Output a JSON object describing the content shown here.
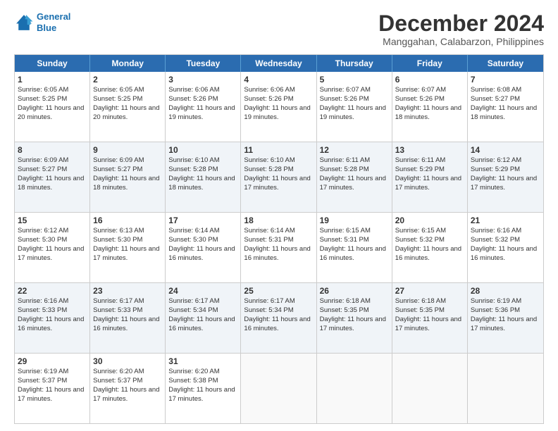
{
  "header": {
    "logo_line1": "General",
    "logo_line2": "Blue",
    "month": "December 2024",
    "location": "Manggahan, Calabarzon, Philippines"
  },
  "weekdays": [
    "Sunday",
    "Monday",
    "Tuesday",
    "Wednesday",
    "Thursday",
    "Friday",
    "Saturday"
  ],
  "rows": [
    [
      {
        "day": "1",
        "rise": "6:05 AM",
        "set": "5:25 PM",
        "daylight": "11 hours and 20 minutes."
      },
      {
        "day": "2",
        "rise": "6:05 AM",
        "set": "5:25 PM",
        "daylight": "11 hours and 20 minutes."
      },
      {
        "day": "3",
        "rise": "6:06 AM",
        "set": "5:26 PM",
        "daylight": "11 hours and 19 minutes."
      },
      {
        "day": "4",
        "rise": "6:06 AM",
        "set": "5:26 PM",
        "daylight": "11 hours and 19 minutes."
      },
      {
        "day": "5",
        "rise": "6:07 AM",
        "set": "5:26 PM",
        "daylight": "11 hours and 19 minutes."
      },
      {
        "day": "6",
        "rise": "6:07 AM",
        "set": "5:26 PM",
        "daylight": "11 hours and 18 minutes."
      },
      {
        "day": "7",
        "rise": "6:08 AM",
        "set": "5:27 PM",
        "daylight": "11 hours and 18 minutes."
      }
    ],
    [
      {
        "day": "8",
        "rise": "6:09 AM",
        "set": "5:27 PM",
        "daylight": "11 hours and 18 minutes."
      },
      {
        "day": "9",
        "rise": "6:09 AM",
        "set": "5:27 PM",
        "daylight": "11 hours and 18 minutes."
      },
      {
        "day": "10",
        "rise": "6:10 AM",
        "set": "5:28 PM",
        "daylight": "11 hours and 18 minutes."
      },
      {
        "day": "11",
        "rise": "6:10 AM",
        "set": "5:28 PM",
        "daylight": "11 hours and 17 minutes."
      },
      {
        "day": "12",
        "rise": "6:11 AM",
        "set": "5:28 PM",
        "daylight": "11 hours and 17 minutes."
      },
      {
        "day": "13",
        "rise": "6:11 AM",
        "set": "5:29 PM",
        "daylight": "11 hours and 17 minutes."
      },
      {
        "day": "14",
        "rise": "6:12 AM",
        "set": "5:29 PM",
        "daylight": "11 hours and 17 minutes."
      }
    ],
    [
      {
        "day": "15",
        "rise": "6:12 AM",
        "set": "5:30 PM",
        "daylight": "11 hours and 17 minutes."
      },
      {
        "day": "16",
        "rise": "6:13 AM",
        "set": "5:30 PM",
        "daylight": "11 hours and 17 minutes."
      },
      {
        "day": "17",
        "rise": "6:14 AM",
        "set": "5:30 PM",
        "daylight": "11 hours and 16 minutes."
      },
      {
        "day": "18",
        "rise": "6:14 AM",
        "set": "5:31 PM",
        "daylight": "11 hours and 16 minutes."
      },
      {
        "day": "19",
        "rise": "6:15 AM",
        "set": "5:31 PM",
        "daylight": "11 hours and 16 minutes."
      },
      {
        "day": "20",
        "rise": "6:15 AM",
        "set": "5:32 PM",
        "daylight": "11 hours and 16 minutes."
      },
      {
        "day": "21",
        "rise": "6:16 AM",
        "set": "5:32 PM",
        "daylight": "11 hours and 16 minutes."
      }
    ],
    [
      {
        "day": "22",
        "rise": "6:16 AM",
        "set": "5:33 PM",
        "daylight": "11 hours and 16 minutes."
      },
      {
        "day": "23",
        "rise": "6:17 AM",
        "set": "5:33 PM",
        "daylight": "11 hours and 16 minutes."
      },
      {
        "day": "24",
        "rise": "6:17 AM",
        "set": "5:34 PM",
        "daylight": "11 hours and 16 minutes."
      },
      {
        "day": "25",
        "rise": "6:17 AM",
        "set": "5:34 PM",
        "daylight": "11 hours and 16 minutes."
      },
      {
        "day": "26",
        "rise": "6:18 AM",
        "set": "5:35 PM",
        "daylight": "11 hours and 17 minutes."
      },
      {
        "day": "27",
        "rise": "6:18 AM",
        "set": "5:35 PM",
        "daylight": "11 hours and 17 minutes."
      },
      {
        "day": "28",
        "rise": "6:19 AM",
        "set": "5:36 PM",
        "daylight": "11 hours and 17 minutes."
      }
    ],
    [
      {
        "day": "29",
        "rise": "6:19 AM",
        "set": "5:37 PM",
        "daylight": "11 hours and 17 minutes."
      },
      {
        "day": "30",
        "rise": "6:20 AM",
        "set": "5:37 PM",
        "daylight": "11 hours and 17 minutes."
      },
      {
        "day": "31",
        "rise": "6:20 AM",
        "set": "5:38 PM",
        "daylight": "11 hours and 17 minutes."
      },
      null,
      null,
      null,
      null
    ]
  ]
}
